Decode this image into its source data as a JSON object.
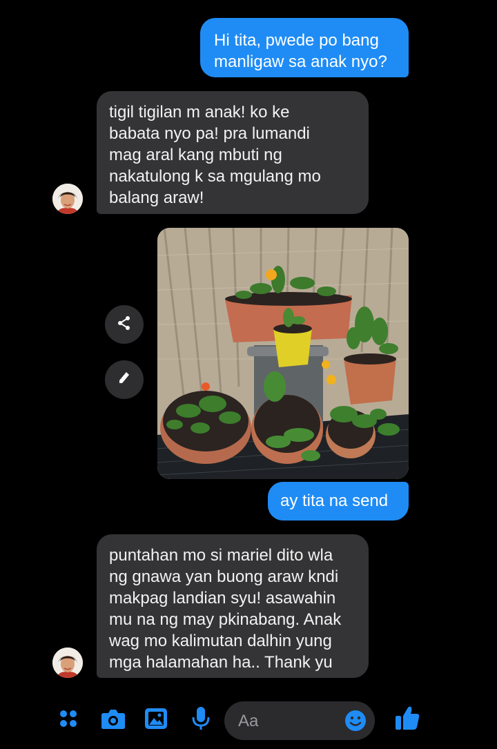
{
  "colors": {
    "background": "#000000",
    "outgoing_bubble": "#1f8cf5",
    "incoming_bubble": "#343436",
    "accent": "#1f8cf5"
  },
  "messages": [
    {
      "direction": "outgoing",
      "text": "Hi tita, pwede po bang\nmanligaw sa anak nyo?"
    },
    {
      "direction": "incoming",
      "text": "tigil tigilan m anak! ko ke\nbabata nyo pa! pra lumandi\nmag aral kang mbuti ng\nnakatulong k sa mgulang mo\nbalang araw!"
    },
    {
      "direction": "outgoing",
      "type": "image",
      "image_subject": "potted plants on a porch"
    },
    {
      "direction": "outgoing",
      "text": "ay tita na send"
    },
    {
      "direction": "incoming",
      "text": "puntahan mo si mariel dito wla\nng gnawa yan buong araw kndi\nmakpag landian syu! asawahin\nmu na ng may pkinabang. Anak\nwag mo kalimutan dalhin yung\nmga halamahan ha.. Thank yu"
    }
  ],
  "image_actions": {
    "share_icon": "share-icon",
    "edit_icon": "pencil-icon"
  },
  "composer": {
    "placeholder": "Aa",
    "icons": [
      "apps-icon",
      "camera-icon",
      "gallery-icon",
      "microphone-icon",
      "emoji-icon",
      "thumbs-up-icon"
    ]
  }
}
